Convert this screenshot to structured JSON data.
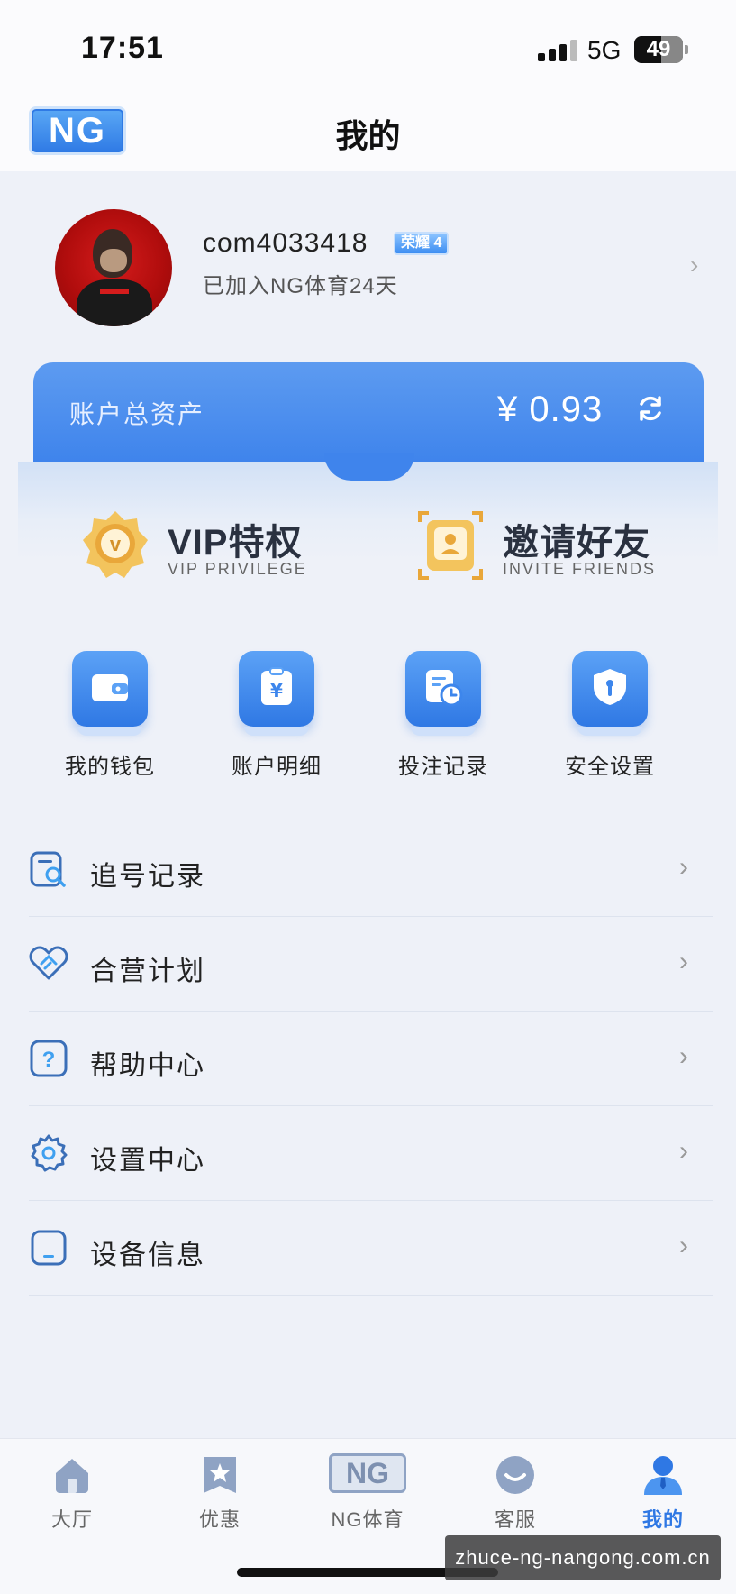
{
  "status_bar": {
    "time": "17:51",
    "network": "5G",
    "battery": "49"
  },
  "header": {
    "logo": "NG",
    "title": "我的"
  },
  "profile": {
    "username": "com4033418",
    "badge": "荣耀 4",
    "joined": "已加入NG体育24天"
  },
  "assets": {
    "label": "账户总资产",
    "value": "¥ 0.93"
  },
  "privileges": [
    {
      "title": "VIP特权",
      "subtitle": "VIP PRIVILEGE",
      "icon": "vip-icon"
    },
    {
      "title": "邀请好友",
      "subtitle": "INVITE FRIENDS",
      "icon": "invite-icon"
    }
  ],
  "quick_actions": [
    {
      "label": "我的钱包",
      "icon": "wallet-icon"
    },
    {
      "label": "账户明细",
      "icon": "account-detail-icon"
    },
    {
      "label": "投注记录",
      "icon": "bet-record-icon"
    },
    {
      "label": "安全设置",
      "icon": "security-icon"
    }
  ],
  "menu": [
    {
      "label": "追号记录",
      "icon": "search-record-icon"
    },
    {
      "label": "合营计划",
      "icon": "handshake-icon"
    },
    {
      "label": "帮助中心",
      "icon": "help-icon"
    },
    {
      "label": "设置中心",
      "icon": "gear-icon"
    },
    {
      "label": "设备信息",
      "icon": "device-icon"
    }
  ],
  "bottom_nav": [
    {
      "label": "大厅",
      "icon": "home-icon"
    },
    {
      "label": "优惠",
      "icon": "star-icon"
    },
    {
      "label": "NG体育",
      "icon": "ng-logo-icon",
      "logo": "NG"
    },
    {
      "label": "客服",
      "icon": "support-icon"
    },
    {
      "label": "我的",
      "icon": "user-icon",
      "active": true
    }
  ],
  "watermark": "zhuce-ng-nangong.com.cn",
  "colors": {
    "accent": "#2f78e4",
    "card": "#4a8cee",
    "background": "#eef1f8"
  }
}
